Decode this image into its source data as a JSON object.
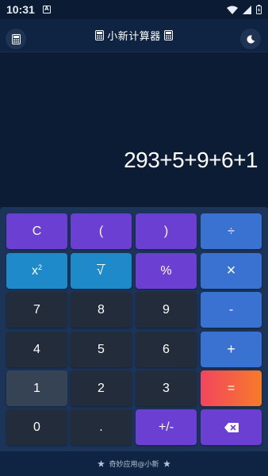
{
  "status": {
    "time": "10:31",
    "notif_glyph": "A"
  },
  "header": {
    "title": "小新计算器"
  },
  "display": {
    "expression": "293+5+9+6+1"
  },
  "keys": {
    "clear": "C",
    "lparen": "(",
    "rparen": ")",
    "divide": "÷",
    "square": "x",
    "square_sup": "2",
    "sqrt": "√",
    "percent": "%",
    "multiply": "×",
    "k7": "7",
    "k8": "8",
    "k9": "9",
    "minus": "-",
    "k4": "4",
    "k5": "5",
    "k6": "6",
    "plus": "+",
    "k1": "1",
    "k2": "2",
    "k3": "3",
    "equals": "=",
    "k0": "0",
    "dot": ".",
    "sign": "+/-"
  },
  "footer": {
    "text": "奇妙应用@小新"
  },
  "colors": {
    "purple": "#6a3fd1",
    "blue": "#3a72d2",
    "cyan": "#1f8ac9",
    "dark": "#232c3b",
    "orange_start": "#f2455f",
    "orange_end": "#f77a2a",
    "background": "#0c1c35"
  },
  "icons": [
    "calculator-icon",
    "moon-icon",
    "backspace-icon",
    "star-icon",
    "wifi-icon",
    "signal-icon",
    "battery-icon"
  ]
}
